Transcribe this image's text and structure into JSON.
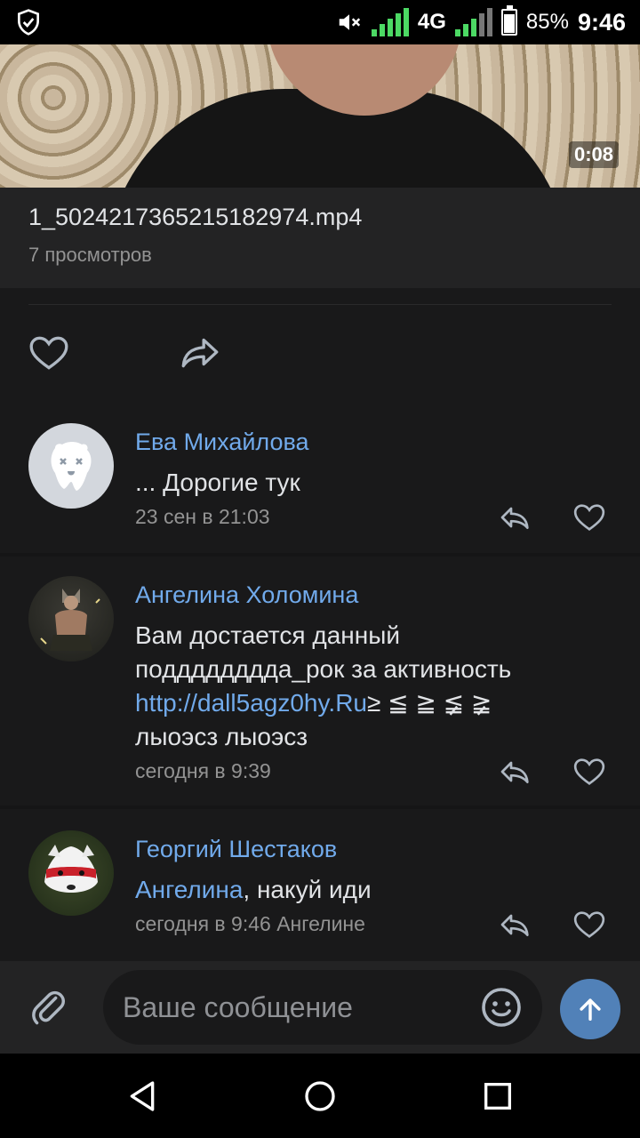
{
  "status_bar": {
    "signal_type": "4G",
    "battery": "85%",
    "time": "9:46"
  },
  "video": {
    "duration": "0:08",
    "file_name": "1_5024217365215182974.mp4",
    "views": "7 просмотров"
  },
  "comments": [
    {
      "author": "Ева Михайлова",
      "text": "... Дорогие тук",
      "meta": "23 сен в 21:03"
    },
    {
      "author": "Ангелина Холомина",
      "text_line1": "Вам достается данный",
      "text_line2": "поддддддддa_рок за активность",
      "link": "http://dall5agz0hy.Ru",
      "text_after_link": "≥ ≦ ≧ ≨ ≩",
      "text_line4": "лыоэсз лыоэсз",
      "meta": "сегодня в 9:39"
    },
    {
      "author": "Георгий Шестаков",
      "mention": "Ангелина",
      "text": ", накуй иди",
      "meta": "сегодня в 9:46 Ангелине"
    }
  ],
  "input": {
    "placeholder": "Ваше сообщение"
  },
  "colors": {
    "background": "#19191a",
    "panel": "#232324",
    "accent": "#71aaeb",
    "send_button": "#5181b8"
  }
}
